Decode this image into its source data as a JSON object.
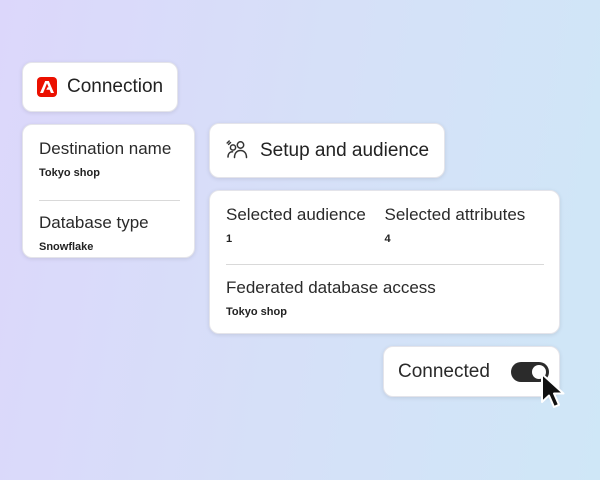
{
  "connection": {
    "title": "Connection",
    "logo_icon": "adobe-logo-icon",
    "logo_color": "#eb1000"
  },
  "destination": {
    "name_label": "Destination name",
    "name_value": "Tokyo shop",
    "type_label": "Database type",
    "type_value": "Snowflake"
  },
  "setup": {
    "title": "Setup and audience",
    "icon": "audience-icon"
  },
  "audience": {
    "selected_audience_label": "Selected audience",
    "selected_audience_value": "1",
    "selected_attributes_label": "Selected attributes",
    "selected_attributes_value": "4",
    "federated_label": "Federated database access",
    "federated_value": "Tokyo shop"
  },
  "status": {
    "label": "Connected",
    "toggle_on": true,
    "toggle_color": "#2b2b2b"
  }
}
